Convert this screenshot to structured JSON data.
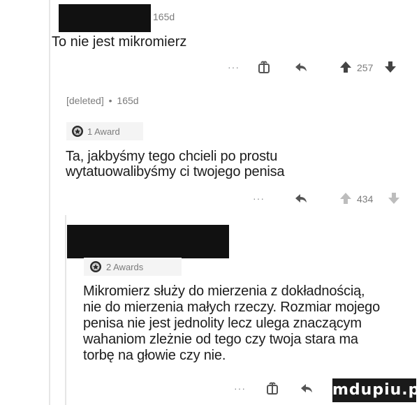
{
  "comment1": {
    "age": "165d",
    "text": "To nie jest mikromierz",
    "actions": {
      "more": "···",
      "score": "257"
    }
  },
  "comment2": {
    "author": "[deleted]",
    "separator": "•",
    "age": "165d",
    "award": "1 Award",
    "text_lines": [
      "Ta, jakbyśmy tego chcieli po prostu",
      "wytatuowalibyśmy ci twojego penisa"
    ],
    "actions": {
      "more": "···",
      "score": "434"
    }
  },
  "comment3": {
    "award": "2 Awards",
    "text_lines": [
      "Mikromierz służy do mierzenia z dokładnością,",
      "nie do mierzenia małych rzeczy. Rozmiar mojego",
      "penisa nie jest jednolity lecz ulega znaczącym",
      "wahaniom zleżnie od tego czy twoja stara ma",
      "torbę na głowie czy nie."
    ],
    "actions": {
      "more": "···"
    }
  },
  "watermark": "mdupiu.pl",
  "colors": {
    "text": "#1c1c1c",
    "muted": "#7c7c7c",
    "icon": "#878a8c",
    "upvote_active": "#555555"
  },
  "icons": [
    "award-icon",
    "reply-icon",
    "upvote-icon",
    "downvote-icon",
    "gift-icon"
  ]
}
